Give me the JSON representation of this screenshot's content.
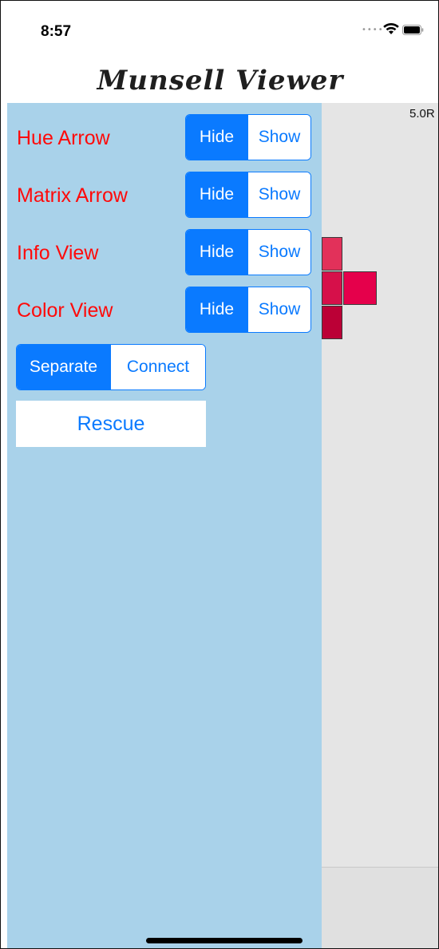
{
  "status_bar": {
    "time": "8:57",
    "signal_icon": "signal-dots-icon",
    "wifi_icon": "wifi-icon",
    "battery_icon": "battery-icon"
  },
  "nav": {
    "title": "Munsell Viewer"
  },
  "viewer": {
    "hue_label": "5.0R",
    "swatches": [
      {
        "name": "swatch-1",
        "color": "#e2315a"
      },
      {
        "name": "swatch-2",
        "color": "#d6104a"
      },
      {
        "name": "swatch-3",
        "color": "#e5004b"
      },
      {
        "name": "swatch-4",
        "color": "#bb0036"
      }
    ]
  },
  "panel": {
    "rows": [
      {
        "label": "Hue Arrow",
        "hide": "Hide",
        "show": "Show",
        "selected": "Hide"
      },
      {
        "label": "Matrix Arrow",
        "hide": "Hide",
        "show": "Show",
        "selected": "Hide"
      },
      {
        "label": "Info View",
        "hide": "Hide",
        "show": "Show",
        "selected": "Hide"
      },
      {
        "label": "Color View",
        "hide": "Hide",
        "show": "Show",
        "selected": "Hide"
      }
    ],
    "mode": {
      "separate": "Separate",
      "connect": "Connect",
      "selected": "Separate"
    },
    "rescue_label": "Rescue"
  },
  "colors": {
    "panel_bg": "#a9d2ea",
    "accent": "#0a7aff",
    "label_red": "#ff0a0a"
  }
}
